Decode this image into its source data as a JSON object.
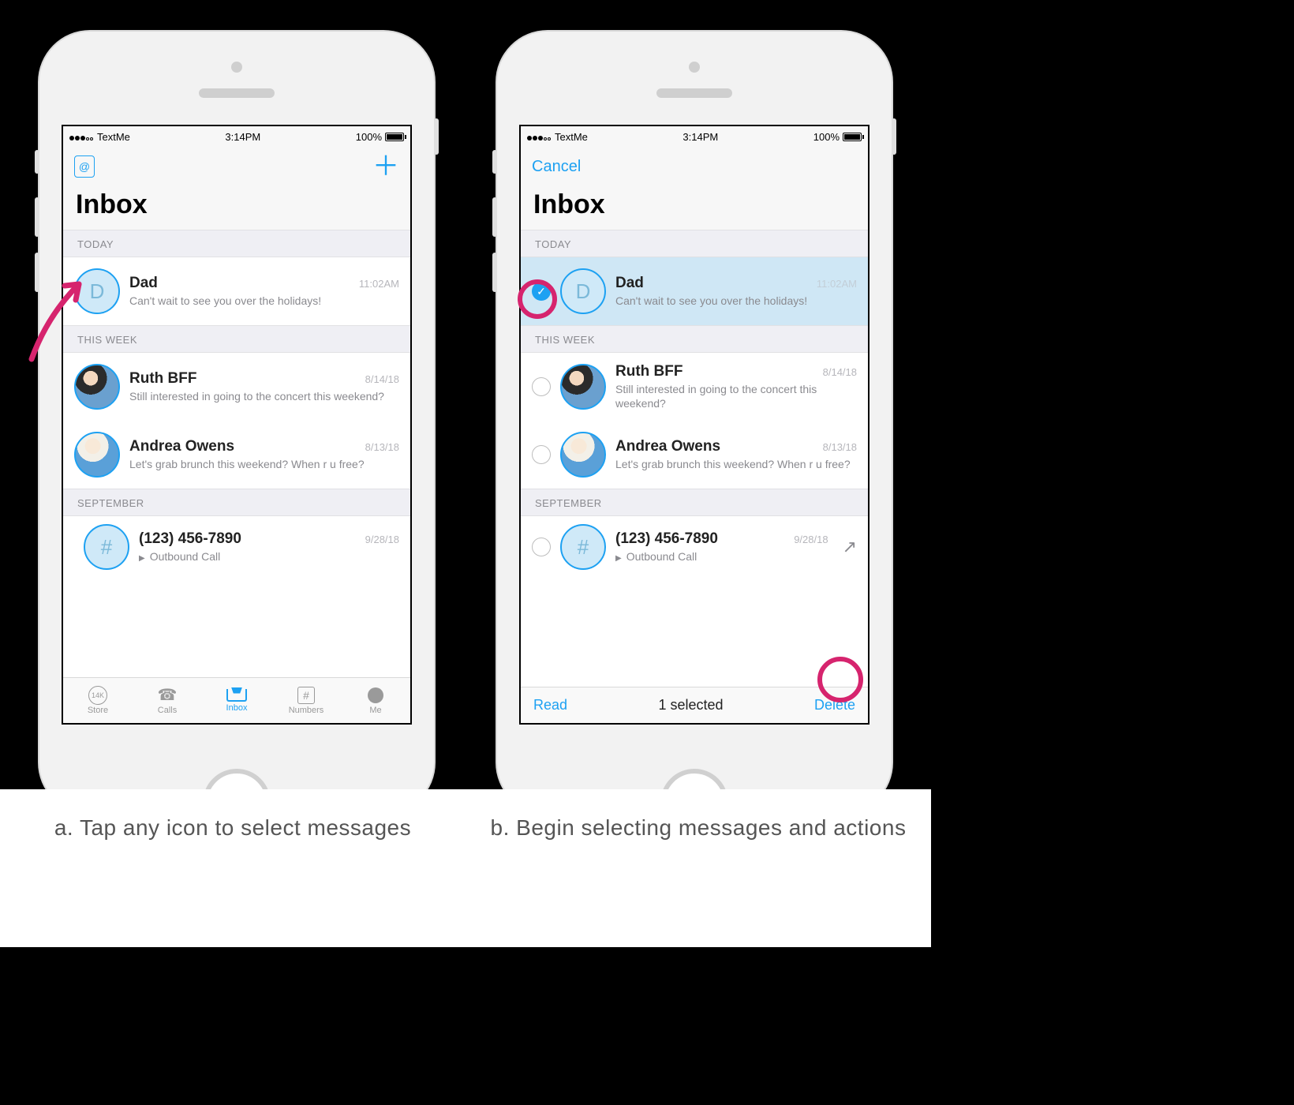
{
  "status": {
    "carrier": "TextMe",
    "time": "3:14PM",
    "battery": "100%"
  },
  "navA": {
    "page_title": "Inbox"
  },
  "navB": {
    "cancel": "Cancel",
    "page_title": "Inbox"
  },
  "sections": {
    "today": "TODAY",
    "this_week": "THIS WEEK",
    "september": "SEPTEMBER"
  },
  "rows": {
    "dad": {
      "title": "Dad",
      "time": "11:02AM",
      "sub": "Can't wait to see you over the holidays!",
      "avatar_letter": "D"
    },
    "ruth": {
      "title": "Ruth BFF",
      "time": "8/14/18",
      "sub": "Still interested in going to the concert this weekend?"
    },
    "andrea": {
      "title": "Andrea Owens",
      "time": "8/13/18",
      "sub": "Let's grab brunch this weekend? When r u free?"
    },
    "num": {
      "title": "(123) 456-7890",
      "time": "9/28/18",
      "sub": "Outbound Call",
      "avatar_hash": "#"
    }
  },
  "tabs": {
    "store": "Store",
    "calls": "Calls",
    "inbox": "Inbox",
    "numbers": "Numbers",
    "me": "Me"
  },
  "actionbar": {
    "read": "Read",
    "count": "1 selected",
    "delete": "Delete"
  },
  "captions": {
    "a": "a. Tap any icon to select messages",
    "b": "b. Begin selecting messages and actions"
  },
  "annotation": {
    "accent": "#d6246e"
  }
}
